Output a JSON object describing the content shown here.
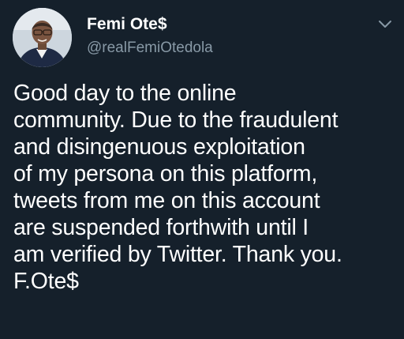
{
  "tweet": {
    "author": {
      "display_name": "Femi Ote$",
      "handle": "@realFemiOtedola",
      "avatar_icon": "profile-photo",
      "more_icon": "chevron-down-icon"
    },
    "text_lines": [
      "Good day to the online",
      "community. Due to the fraudulent",
      "and disingenuous exploitation",
      "of my persona on this platform,",
      "tweets from me on this account",
      "are suspended forthwith until I",
      "am verified by Twitter. Thank you.",
      "F.Ote$"
    ]
  },
  "colors": {
    "background": "#15202b",
    "text_primary": "#ffffff",
    "text_secondary": "#8899a6"
  }
}
